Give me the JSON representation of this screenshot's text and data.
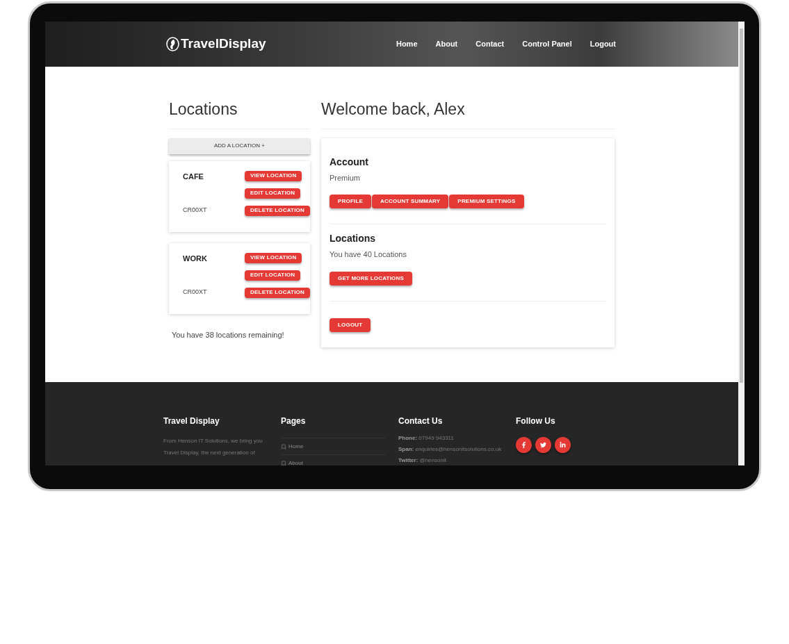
{
  "header": {
    "logo": "TravelDisplay",
    "nav": [
      {
        "label": "Home"
      },
      {
        "label": "About"
      },
      {
        "label": "Contact"
      },
      {
        "label": "Control Panel"
      },
      {
        "label": "Logout"
      }
    ]
  },
  "locations_panel": {
    "title": "Locations",
    "add_button": "ADD A LOCATION +",
    "locations": [
      {
        "name": "CAFE",
        "code": "CR00XT",
        "actions": [
          "VIEW LOCATION",
          "EDIT LOCATION",
          "DELETE LOCATION"
        ]
      },
      {
        "name": "WORK",
        "code": "CR00XT",
        "actions": [
          "VIEW LOCATION",
          "EDIT LOCATION",
          "DELETE LOCATION"
        ]
      }
    ],
    "remaining": "You have 38 locations remaining!"
  },
  "dashboard": {
    "title": "Welcome back, Alex",
    "sections": [
      {
        "heading": "Account",
        "text": "Premium",
        "buttons": [
          "PROFILE",
          "ACCOUNT SUMMARY",
          "PREMIUM SETTINGS"
        ]
      },
      {
        "heading": "Locations",
        "text": "You have 40 Locations",
        "buttons": [
          "GET MORE LOCATIONS"
        ]
      },
      {
        "buttons": [
          "LOGOUT"
        ]
      }
    ]
  },
  "footer": {
    "about": {
      "title": "Travel Display",
      "lines": [
        "From Henson IT Solutions, we bring you",
        "Travel Display, the next generation of"
      ]
    },
    "pages": {
      "title": "Pages",
      "links": [
        "Home",
        "About"
      ]
    },
    "contact": {
      "title": "Contact Us",
      "items": [
        {
          "label": "Phone:",
          "value": "07949 943311"
        },
        {
          "label": "Span:",
          "value": "enquiries@hensonitsolutions.co.uk"
        },
        {
          "label": "Twitter:",
          "value": "@hensonit"
        }
      ]
    },
    "follow": {
      "title": "Follow Us",
      "links": [
        {
          "kind": "facebook"
        },
        {
          "kind": "twitter"
        },
        {
          "kind": "linkedin"
        }
      ]
    }
  }
}
